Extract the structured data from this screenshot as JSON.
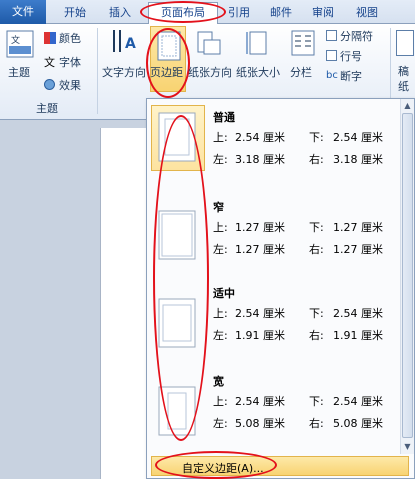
{
  "tabs": [
    "文件",
    "开始",
    "插入",
    "页面布局",
    "引用",
    "邮件",
    "审阅",
    "视图"
  ],
  "ribbon": {
    "theme_label": "主题",
    "colors_label": "颜色",
    "fonts_label": "字体",
    "effects_label": "效果",
    "group_label": "主题",
    "text_direction_label": "文字方向",
    "margins_label": "页边距",
    "orientation_label": "纸张方向",
    "size_label": "纸张大小",
    "columns_label": "分栏",
    "breaks_label": "分隔符",
    "line_numbers_label": "行号",
    "hyphenation_label": "断字",
    "watermark_label": "稿纸设置"
  },
  "margins_menu": {
    "presets": [
      {
        "name": "普通",
        "top": "2.54 厘米",
        "bottom": "2.54 厘米",
        "left": "3.18 厘米",
        "right": "3.18 厘米"
      },
      {
        "name": "窄",
        "top": "1.27 厘米",
        "bottom": "1.27 厘米",
        "left": "1.27 厘米",
        "right": "1.27 厘米"
      },
      {
        "name": "适中",
        "top": "2.54 厘米",
        "bottom": "2.54 厘米",
        "left": "1.91 厘米",
        "right": "1.91 厘米"
      },
      {
        "name": "宽",
        "top": "2.54 厘米",
        "bottom": "2.54 厘米",
        "left": "5.08 厘米",
        "right": "5.08 厘米"
      }
    ],
    "k_top": "上:",
    "k_bottom": "下:",
    "k_left": "左:",
    "k_right": "右:",
    "custom_label": "自定义边距(A)..."
  },
  "colors": {
    "annotation": "#e3111b",
    "highlight": "#f8d372"
  }
}
